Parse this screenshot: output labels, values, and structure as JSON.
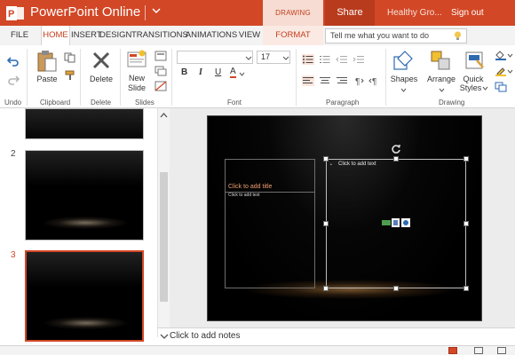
{
  "titlebar": {
    "app_title": "PowerPoint Online",
    "contextual_tools": "DRAWING TOOLS",
    "share_label": "Share",
    "doc_name": "Healthy Gro...",
    "signout_label": "Sign out"
  },
  "tabs": [
    {
      "label": "FILE"
    },
    {
      "label": "HOME"
    },
    {
      "label": "INSERT"
    },
    {
      "label": "DESIGN"
    },
    {
      "label": "TRANSITIONS"
    },
    {
      "label": "ANIMATIONS"
    },
    {
      "label": "VIEW"
    },
    {
      "label": "FORMAT"
    }
  ],
  "active_tab": "HOME",
  "tell_me": {
    "placeholder": "Tell me what you want to do"
  },
  "ribbon": {
    "groups": {
      "undo": "Undo",
      "clipboard": "Clipboard",
      "delete": "Delete",
      "slides": "Slides",
      "font": "Font",
      "paragraph": "Paragraph",
      "drawing": "Drawing"
    },
    "buttons": {
      "paste": "Paste",
      "delete": "Delete",
      "new_slide_1": "New",
      "new_slide_2": "Slide",
      "shapes": "Shapes",
      "arrange": "Arrange",
      "quick_styles_1": "Quick",
      "quick_styles_2": "Styles"
    },
    "font": {
      "name": "",
      "size": "17",
      "bold": "B",
      "italic": "I",
      "underline": "U",
      "color": "A"
    }
  },
  "slides": [
    {
      "number": "",
      "selected": false
    },
    {
      "number": "2",
      "selected": false
    },
    {
      "number": "3",
      "selected": true
    }
  ],
  "slide": {
    "title_placeholder": "Click to add title",
    "text_placeholder_left": "Click to add text",
    "text_placeholder_right": "Click to add text"
  },
  "notes": {
    "placeholder": "Click to add notes"
  },
  "colors": {
    "brand": "#d24726",
    "share": "#b83b1d",
    "accent_text": "#c43e1c",
    "title_placeholder": "#f0a070"
  }
}
